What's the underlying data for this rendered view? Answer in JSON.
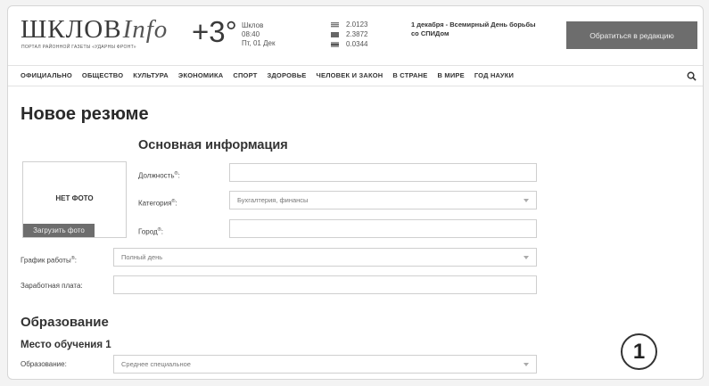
{
  "header": {
    "logo_main": "ШКЛОВ",
    "logo_info": "Info",
    "logo_tagline": "ПОРТАЛ РАЙОННОЙ ГАЗЕТЫ «УДАРНЫ ФРОНТ»",
    "weather": {
      "temperature": "+3°",
      "city": "Шклов",
      "time": "08:40",
      "date": "Пт, 01 Дек"
    },
    "rates": [
      {
        "flag": "flag-usd-icon",
        "value": "2.0123"
      },
      {
        "flag": "flag-eur-icon",
        "value": "2.3872"
      },
      {
        "flag": "flag-rub-icon",
        "value": "0.0344"
      }
    ],
    "news": "1 декабря - Всемирный День борьбы со СПИДом",
    "editor_button": "Обратиться в редакцию"
  },
  "nav": {
    "items": [
      "ОФИЦИАЛЬНО",
      "ОБЩЕСТВО",
      "КУЛЬТУРА",
      "ЭКОНОМИКА",
      "СПОРТ",
      "ЗДОРОВЬЕ",
      "ЧЕЛОВЕК И ЗАКОН",
      "В СТРАНЕ",
      "В МИРЕ",
      "ГОД НАУКИ"
    ],
    "search_icon": "search-icon"
  },
  "page": {
    "title": "Новое резюме",
    "section_main": "Основная информация",
    "no_photo": "НЕТ ФОТО",
    "upload_photo": "Загрузить фото",
    "fields": {
      "position_label": "Должность",
      "category_label": "Категория",
      "category_value": "Бухгалтерия, финансы",
      "city_label": "Город",
      "schedule_label": "График работы",
      "schedule_value": "Полный день",
      "salary_label": "Заработная плата:",
      "required_mark": "®"
    },
    "education_title": "Образование",
    "place_title": "Место обучения 1",
    "education_label": "Образование:",
    "education_value": "Среднее специальное"
  },
  "badge": "1"
}
